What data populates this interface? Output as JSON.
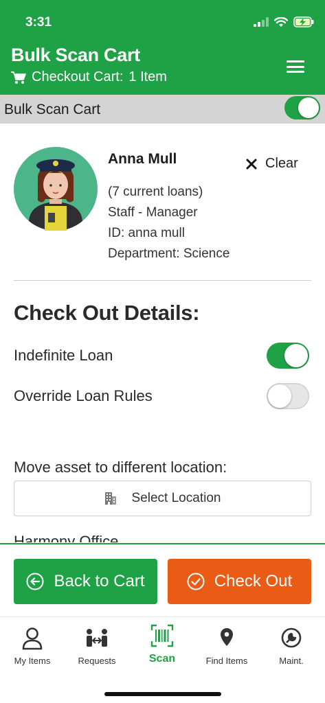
{
  "status_bar": {
    "time": "3:31"
  },
  "header": {
    "title": "Bulk Scan Cart",
    "cart_label": "Checkout Cart:",
    "cart_count": "1 Item"
  },
  "bulk_scan": {
    "label": "Bulk Scan Cart",
    "enabled": true
  },
  "user": {
    "name": "Anna Mull",
    "clear_label": "Clear",
    "loans": "(7 current loans)",
    "role": "Staff - Manager",
    "id": "ID: anna mull",
    "department": "Department: Science"
  },
  "checkout_details": {
    "title": "Check Out Details:",
    "indefinite_loan": {
      "label": "Indefinite Loan",
      "enabled": true
    },
    "override_rules": {
      "label": "Override Loan Rules",
      "enabled": false
    },
    "move_label": "Move asset to different location:",
    "select_location": "Select Location",
    "partial_text": "Harmony Office"
  },
  "actions": {
    "back": "Back to Cart",
    "checkout": "Check Out"
  },
  "tabs": [
    {
      "label": "My Items",
      "icon": "person-icon",
      "active": false
    },
    {
      "label": "Requests",
      "icon": "exchange-icon",
      "active": false
    },
    {
      "label": "Scan",
      "icon": "barcode-icon",
      "active": true
    },
    {
      "label": "Find Items",
      "icon": "location-pin-icon",
      "active": false
    },
    {
      "label": "Maint.",
      "icon": "maintenance-icon",
      "active": false
    }
  ],
  "colors": {
    "brand_green": "#1fa145",
    "checkout_orange": "#ea5b16",
    "bulk_bar_gray": "#d4d4d4"
  }
}
